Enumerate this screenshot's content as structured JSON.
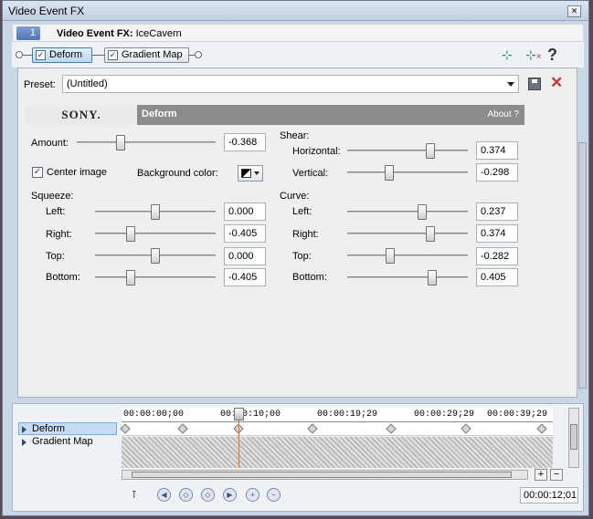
{
  "window": {
    "title": "Video Event FX"
  },
  "header": {
    "chain_number": "1",
    "prefix": "Video Event FX:",
    "event_name": "IceCavern"
  },
  "chain": {
    "items": [
      "Deform",
      "Gradient Map"
    ]
  },
  "icons": {
    "add_plugin": "plugin-add-icon",
    "remove_plugin": "plugin-remove-icon",
    "help": "help-icon",
    "save": "save-icon",
    "delete": "delete-icon"
  },
  "help_glyph": "?",
  "preset": {
    "label": "Preset:",
    "value": "(Untitled)"
  },
  "banner": {
    "logo": "SONY.",
    "plugin": "Deform",
    "about": "About  ?"
  },
  "controls": {
    "amount": {
      "label": "Amount:",
      "value": "-0.368",
      "level": 0.316
    },
    "center_image": {
      "label": "Center image",
      "checked": true
    },
    "background_color": {
      "label": "Background color:"
    },
    "squeeze": {
      "label": "Squeeze:",
      "left": {
        "label": "Left:",
        "value": "0.000",
        "level": 0.5
      },
      "right": {
        "label": "Right:",
        "value": "-0.405",
        "level": 0.297
      },
      "top": {
        "label": "Top:",
        "value": "0.000",
        "level": 0.5
      },
      "bottom": {
        "label": "Bottom:",
        "value": "-0.405",
        "level": 0.297
      }
    },
    "shear": {
      "label": "Shear:",
      "horizontal": {
        "label": "Horizontal:",
        "value": "0.374",
        "level": 0.687
      },
      "vertical": {
        "label": "Vertical:",
        "value": "-0.298",
        "level": 0.351
      }
    },
    "curve": {
      "label": "Curve:",
      "left": {
        "label": "Left:",
        "value": "0.237",
        "level": 0.618
      },
      "right": {
        "label": "Right:",
        "value": "0.374",
        "level": 0.687
      },
      "top": {
        "label": "Top:",
        "value": "-0.282",
        "level": 0.359
      },
      "bottom": {
        "label": "Bottom:",
        "value": "0.405",
        "level": 0.702
      }
    }
  },
  "timeline": {
    "tracks": [
      "Deform",
      "Gradient Map"
    ],
    "ruler": [
      "00:00:00;00",
      "00:00:10;00",
      "00:00:19;29",
      "00:00:29;29",
      "00:00:39;29"
    ],
    "current_time": "00:00:12;01",
    "scroll_buttons": {
      "plus": "+",
      "minus": "−"
    }
  }
}
